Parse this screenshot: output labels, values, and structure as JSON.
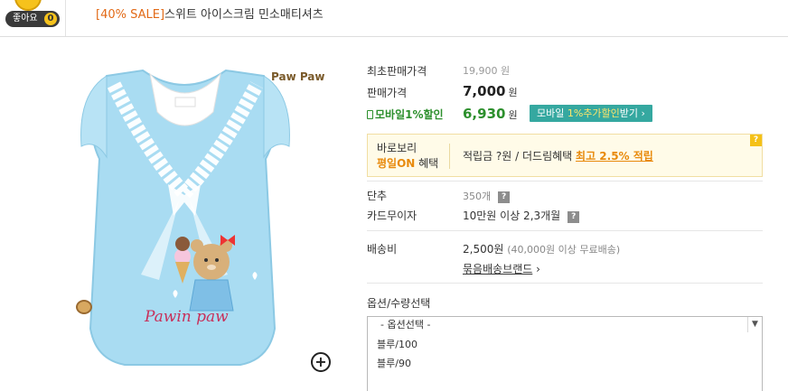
{
  "header": {
    "like_label": "좋아요",
    "like_count": "0",
    "sale_tag": "[40% SALE]",
    "product_title": "스위트 아이스크림 민소매티셔츠"
  },
  "image": {
    "brand_logo": "Paw Paw",
    "print_text": "Pawin paw"
  },
  "pricing": {
    "original_label": "최초판매가격",
    "original_value": "19,900 원",
    "sale_label": "판매가격",
    "sale_value": "7,000",
    "sale_unit": "원",
    "mobile_label": "모바일1%할인",
    "mobile_value": "6,930",
    "mobile_unit": "원",
    "mobile_btn_pre": "모바일 ",
    "mobile_btn_hl": "1%추가할인",
    "mobile_btn_post": "받기 ›"
  },
  "benefit": {
    "title_line1": "바로보리",
    "title_on": "평일ON",
    "title_suffix": " 혜택",
    "text": "적립금 ?원 / 더드림혜택 ",
    "highlight": "최고 2.5% 적립",
    "help": "?"
  },
  "details": {
    "sold_label": "단추",
    "sold_value": "350개",
    "card_label": "카드무이자",
    "card_value": "10만원 이상 2,3개월",
    "shipping_label": "배송비",
    "shipping_value": "2,500원",
    "shipping_note": "(40,000원 이상 무료배송)",
    "bundle_link": "묶음배송브랜드",
    "bundle_arrow": " ›"
  },
  "options": {
    "label": "옵션/수량선택",
    "placeholder": "- 옵션선택 -",
    "items": [
      "블루/100",
      "블루/90"
    ]
  },
  "colors": {
    "sale_orange": "#e26a17",
    "mobile_green": "#2c8f2c",
    "mobile_button": "#35a8a0",
    "benefit_bg": "#fffbe8",
    "like_yellow": "#f6c21c"
  }
}
